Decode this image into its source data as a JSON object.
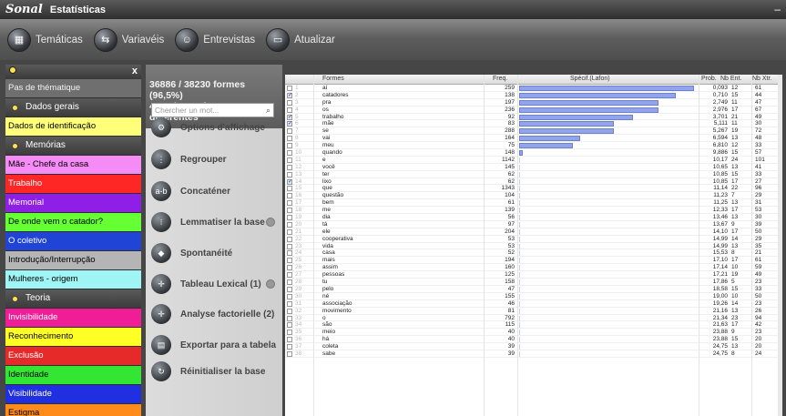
{
  "app": {
    "logo": "Sonal",
    "title": "Estatísticas",
    "min": "–"
  },
  "toolbar": [
    {
      "label": "Temáticas",
      "icon": "themes-icon"
    },
    {
      "label": "Variavéis",
      "icon": "variables-icon"
    },
    {
      "label": "Entrevistas",
      "icon": "interviews-icon"
    },
    {
      "label": "Atualizar",
      "icon": "refresh-icon"
    }
  ],
  "left": {
    "close": "x",
    "items": [
      {
        "type": "item",
        "label": "Pas de thématique",
        "bg": "#6f6f6f",
        "fg": "#f0f0f0"
      },
      {
        "type": "section",
        "label": "Dados gerais"
      },
      {
        "type": "item",
        "label": "Dados de identificação",
        "bg": "#ffff7a",
        "fg": "#000000"
      },
      {
        "type": "section",
        "label": "Memórias"
      },
      {
        "type": "item",
        "label": "Mãe - Chefe da casa",
        "bg": "#f58cf5",
        "fg": "#000000"
      },
      {
        "type": "item",
        "label": "Trabalho",
        "bg": "#ff2626",
        "fg": "#ffffff"
      },
      {
        "type": "item",
        "label": "Memorial",
        "bg": "#8f1ee6",
        "fg": "#ffffff"
      },
      {
        "type": "item",
        "label": "De onde vem o catador?",
        "bg": "#66ff33",
        "fg": "#000000"
      },
      {
        "type": "item",
        "label": "O coletivo",
        "bg": "#1f44d6",
        "fg": "#ffffff"
      },
      {
        "type": "item",
        "label": "Introdução/Interrupção",
        "bg": "#b5b5b5",
        "fg": "#000000"
      },
      {
        "type": "item",
        "label": "Mulheres - origem",
        "bg": "#9ff5f5",
        "fg": "#000000"
      },
      {
        "type": "section",
        "label": "Teoria"
      },
      {
        "type": "item",
        "label": "Invisibilidade",
        "bg": "#f01e96",
        "fg": "#ffffff"
      },
      {
        "type": "item",
        "label": "Reconhecimento",
        "bg": "#ffff26",
        "fg": "#000000"
      },
      {
        "type": "item",
        "label": "Exclusão",
        "bg": "#e62a2a",
        "fg": "#ffffff"
      },
      {
        "type": "item",
        "label": "Identidade",
        "bg": "#33e633",
        "fg": "#000000"
      },
      {
        "type": "item",
        "label": "Visibilidade",
        "bg": "#2030e0",
        "fg": "#ffffff"
      },
      {
        "type": "item",
        "label": "Estigma",
        "bg": "#ff8c1a",
        "fg": "#000000"
      }
    ]
  },
  "mid": {
    "stats1": "36886 / 38230 formes (96,5%)",
    "stats2": "4606 / 4706 formes differentes",
    "search_placeholder": "Chercher un mot...",
    "options": [
      {
        "label": "Options d'affichage",
        "icon": "display-options-icon",
        "glyph": "⚙"
      },
      {
        "label": "Regrouper",
        "icon": "group-icon",
        "glyph": "⋮"
      },
      {
        "label": "Concaténer",
        "icon": "concatenate-icon",
        "glyph": "a-b"
      },
      {
        "label": "Lemmatiser la base",
        "icon": "lemmatize-icon",
        "glyph": "⁝",
        "gear": true
      },
      {
        "label": "Spontanéité",
        "icon": "spontaneity-icon",
        "glyph": "◆"
      },
      {
        "label": "Tableau Lexical (1)",
        "icon": "lexical-table-icon",
        "glyph": "✛",
        "gear": true
      },
      {
        "label": "Analyse factorielle (2)",
        "icon": "factor-analysis-icon",
        "glyph": "✛"
      },
      {
        "label": "Exportar para a tabela",
        "icon": "export-icon",
        "glyph": "▤"
      },
      {
        "label": "Réinitialiser la base",
        "icon": "reset-icon",
        "glyph": "↻"
      }
    ]
  },
  "table": {
    "headers": {
      "formes": "Formes",
      "freq": "Freq.",
      "specif": "Spécif.(Lafon)",
      "prob": "Prob.",
      "nbent": "Nb Ent.",
      "nbxtr": "Nb Xtr."
    },
    "rows": [
      {
        "n": "1",
        "f": "aí",
        "q": "259",
        "b": 0.98,
        "p": "0,093",
        "e": "12",
        "x": "61",
        "c": false
      },
      {
        "n": "2",
        "f": "catadores",
        "q": "138",
        "b": 0.88,
        "p": "0,710",
        "e": "15",
        "x": "44",
        "c": true
      },
      {
        "n": "3",
        "f": "pra",
        "q": "197",
        "b": 0.78,
        "p": "2,749",
        "e": "11",
        "x": "47",
        "c": false
      },
      {
        "n": "4",
        "f": "os",
        "q": "236",
        "b": 0.78,
        "p": "2,976",
        "e": "17",
        "x": "67",
        "c": false
      },
      {
        "n": "5",
        "f": "trabalho",
        "q": "92",
        "b": 0.64,
        "p": "3,701",
        "e": "21",
        "x": "49",
        "c": true
      },
      {
        "n": "6",
        "f": "mãe",
        "q": "83",
        "b": 0.53,
        "p": "5,111",
        "e": "11",
        "x": "30",
        "c": true
      },
      {
        "n": "7",
        "f": "se",
        "q": "288",
        "b": 0.53,
        "p": "5,267",
        "e": "19",
        "x": "72",
        "c": false
      },
      {
        "n": "8",
        "f": "vai",
        "q": "164",
        "b": 0.34,
        "p": "6,594",
        "e": "13",
        "x": "48",
        "c": false
      },
      {
        "n": "9",
        "f": "meu",
        "q": "75",
        "b": 0.3,
        "p": "6,810",
        "e": "12",
        "x": "33",
        "c": false
      },
      {
        "n": "10",
        "f": "quando",
        "q": "148",
        "b": 0.02,
        "p": "9,886",
        "e": "15",
        "x": "57",
        "c": false
      },
      {
        "n": "11",
        "f": "e",
        "q": "1142",
        "b": 0,
        "p": "10,17",
        "e": "24",
        "x": "101",
        "c": false
      },
      {
        "n": "12",
        "f": "você",
        "q": "145",
        "b": 0,
        "p": "10,65",
        "e": "13",
        "x": "41",
        "c": false
      },
      {
        "n": "13",
        "f": "ter",
        "q": "62",
        "b": 0,
        "p": "10,85",
        "e": "15",
        "x": "33",
        "c": false
      },
      {
        "n": "14",
        "f": "lixo",
        "q": "62",
        "b": 0,
        "p": "10,85",
        "e": "17",
        "x": "27",
        "c": true
      },
      {
        "n": "15",
        "f": "que",
        "q": "1343",
        "b": 0,
        "p": "11,14",
        "e": "22",
        "x": "96",
        "c": false
      },
      {
        "n": "16",
        "f": "questão",
        "q": "104",
        "b": 0,
        "p": "11,23",
        "e": "7",
        "x": "29",
        "c": false
      },
      {
        "n": "17",
        "f": "bem",
        "q": "61",
        "b": 0,
        "p": "11,25",
        "e": "13",
        "x": "31",
        "c": false
      },
      {
        "n": "18",
        "f": "me",
        "q": "139",
        "b": 0,
        "p": "12,33",
        "e": "17",
        "x": "53",
        "c": false
      },
      {
        "n": "19",
        "f": "dia",
        "q": "56",
        "b": 0,
        "p": "13,46",
        "e": "13",
        "x": "30",
        "c": false
      },
      {
        "n": "20",
        "f": "tá",
        "q": "97",
        "b": 0,
        "p": "13,67",
        "e": "9",
        "x": "39",
        "c": false
      },
      {
        "n": "21",
        "f": "ele",
        "q": "204",
        "b": 0,
        "p": "14,10",
        "e": "17",
        "x": "50",
        "c": false
      },
      {
        "n": "22",
        "f": "cooperativa",
        "q": "53",
        "b": 0,
        "p": "14,99",
        "e": "14",
        "x": "29",
        "c": false
      },
      {
        "n": "23",
        "f": "vida",
        "q": "53",
        "b": 0,
        "p": "14,99",
        "e": "13",
        "x": "35",
        "c": false
      },
      {
        "n": "24",
        "f": "casa",
        "q": "52",
        "b": 0,
        "p": "15,53",
        "e": "8",
        "x": "21",
        "c": false
      },
      {
        "n": "25",
        "f": "mais",
        "q": "194",
        "b": 0,
        "p": "17,10",
        "e": "17",
        "x": "61",
        "c": false
      },
      {
        "n": "26",
        "f": "assim",
        "q": "160",
        "b": 0,
        "p": "17,14",
        "e": "10",
        "x": "59",
        "c": false
      },
      {
        "n": "27",
        "f": "pessoas",
        "q": "125",
        "b": 0,
        "p": "17,21",
        "e": "19",
        "x": "49",
        "c": false
      },
      {
        "n": "28",
        "f": "tu",
        "q": "158",
        "b": 0,
        "p": "17,86",
        "e": "5",
        "x": "23",
        "c": false
      },
      {
        "n": "29",
        "f": "pelo",
        "q": "47",
        "b": 0,
        "p": "18,58",
        "e": "15",
        "x": "33",
        "c": false
      },
      {
        "n": "30",
        "f": "né",
        "q": "155",
        "b": 0,
        "p": "19,00",
        "e": "10",
        "x": "50",
        "c": false
      },
      {
        "n": "31",
        "f": "associação",
        "q": "46",
        "b": 0,
        "p": "19,26",
        "e": "14",
        "x": "23",
        "c": false
      },
      {
        "n": "32",
        "f": "movimento",
        "q": "81",
        "b": 0,
        "p": "21,16",
        "e": "13",
        "x": "26",
        "c": false
      },
      {
        "n": "33",
        "f": "o",
        "q": "792",
        "b": 0,
        "p": "21,34",
        "e": "23",
        "x": "94",
        "c": false
      },
      {
        "n": "34",
        "f": "são",
        "q": "115",
        "b": 0,
        "p": "21,63",
        "e": "17",
        "x": "42",
        "c": false
      },
      {
        "n": "35",
        "f": "meio",
        "q": "40",
        "b": 0,
        "p": "23,88",
        "e": "9",
        "x": "23",
        "c": false
      },
      {
        "n": "36",
        "f": "há",
        "q": "40",
        "b": 0,
        "p": "23,88",
        "e": "15",
        "x": "20",
        "c": false
      },
      {
        "n": "37",
        "f": "coleta",
        "q": "39",
        "b": 0,
        "p": "24,75",
        "e": "13",
        "x": "20",
        "c": false
      },
      {
        "n": "38",
        "f": "sabe",
        "q": "39",
        "b": 0,
        "p": "24,75",
        "e": "8",
        "x": "24",
        "c": false
      }
    ]
  }
}
